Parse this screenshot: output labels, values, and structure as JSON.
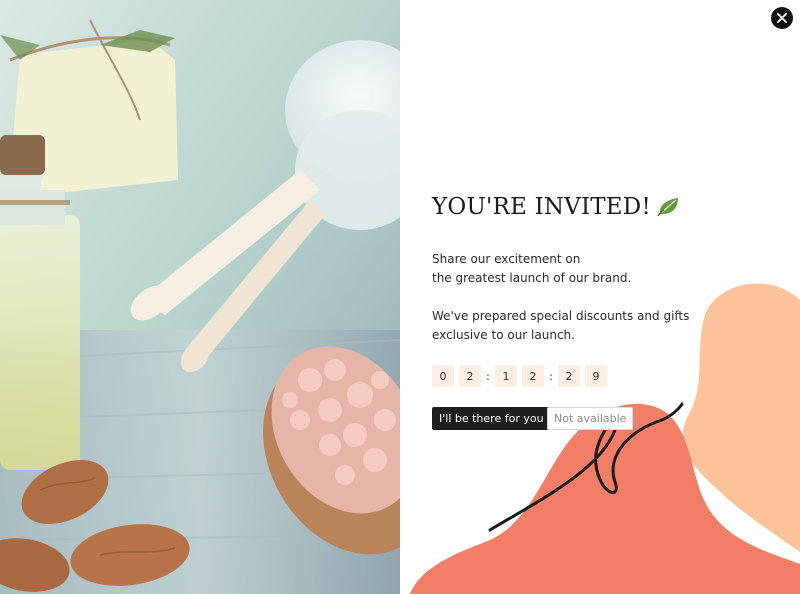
{
  "popup": {
    "title": "YOU'RE INVITED!",
    "title_icon": "leaf-icon",
    "close_icon": "close-icon",
    "description_1": [
      "Share our excitement on",
      "the greatest launch of our brand."
    ],
    "description_2": [
      "We've prepared special discounts and gifts",
      "exclusive to our launch."
    ],
    "countdown": {
      "digits": [
        "0",
        "2",
        "1",
        "2",
        "2",
        "9"
      ],
      "separator": ":"
    },
    "primary_button": "I'll be there for you",
    "secondary_button": "Not available"
  },
  "colors": {
    "blob_coral": "#f47d66",
    "blob_peach": "#fcc39a",
    "digit_bg": "#fdeee3",
    "button_dark": "#1e1e1e"
  }
}
